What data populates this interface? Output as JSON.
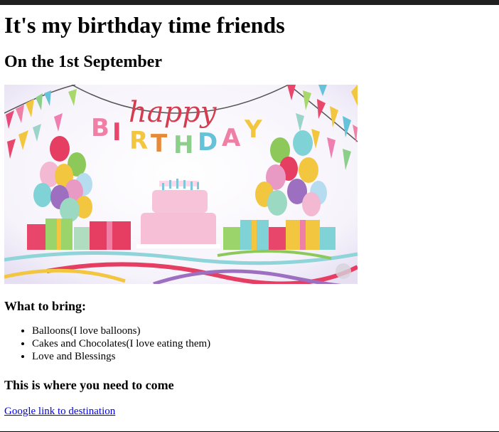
{
  "page": {
    "heading": "It's my birthday time friends",
    "subheading": "On the 1st September"
  },
  "banner": {
    "word_happy": "happy",
    "word_birthday": "BIRTHDAY"
  },
  "bring": {
    "heading": "What to bring:",
    "items": [
      "Balloons(I love balloons)",
      "Cakes and Chocolates(I love eating them)",
      "Love and Blessings"
    ]
  },
  "location": {
    "heading": "This is where you need to come",
    "link_text": "Google link to destination"
  },
  "colors": {
    "link": "#0000ee",
    "topbar": "#202020"
  }
}
